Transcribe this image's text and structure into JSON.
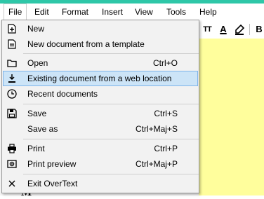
{
  "menubar": {
    "items": [
      "File",
      "Edit",
      "Format",
      "Insert",
      "View",
      "Tools",
      "Help"
    ]
  },
  "file_menu": {
    "items": [
      {
        "label": "New",
        "shortcut": "",
        "icon": "new-document-icon"
      },
      {
        "label": "New document from a template",
        "shortcut": "",
        "icon": "template-icon"
      },
      {
        "label": "Open",
        "shortcut": "Ctrl+O",
        "icon": "folder-icon"
      },
      {
        "label": "Existing document from a web location",
        "shortcut": "",
        "icon": "download-icon"
      },
      {
        "label": "Recent documents",
        "shortcut": "",
        "icon": "clock-icon"
      },
      {
        "label": "Save",
        "shortcut": "Ctrl+S",
        "icon": "save-icon"
      },
      {
        "label": "Save as",
        "shortcut": "Ctrl+Maj+S",
        "icon": ""
      },
      {
        "label": "Print",
        "shortcut": "Ctrl+P",
        "icon": "printer-icon"
      },
      {
        "label": "Print preview",
        "shortcut": "Ctrl+Maj+P",
        "icon": "print-preview-icon"
      },
      {
        "label": "Exit OverText",
        "shortcut": "",
        "icon": "close-icon"
      }
    ]
  },
  "toolbar": {
    "font_size_label": "TT",
    "text_color_label": "A",
    "bold_label": "B"
  },
  "colors": {
    "accent_strip": "#2ec7a8",
    "document_bg": "#fffe9c",
    "highlight_bg": "#cce4f7",
    "highlight_border": "#7eb4ea"
  }
}
